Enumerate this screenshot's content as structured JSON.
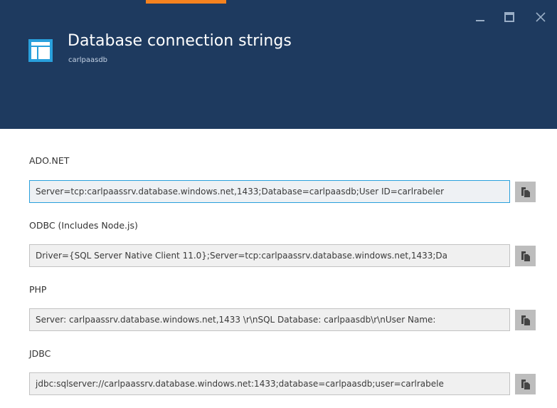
{
  "blade": {
    "title": "Database connection strings",
    "subtitle": "carlpaasdb",
    "icon": "blade-layout-icon",
    "colors": {
      "header_bg": "#1e3a5f",
      "accent": "#f5821f",
      "focus_border": "#29a0dc"
    }
  },
  "window_controls": {
    "minimize_icon": "minimize-icon",
    "maximize_icon": "maximize-icon",
    "close_icon": "close-icon"
  },
  "connection_strings": [
    {
      "label": "ADO.NET",
      "value": "Server=tcp:carlpaassrv.database.windows.net,1433;Database=carlpaasdb;User ID=carlrabeler",
      "copy_icon": "copy-icon"
    },
    {
      "label": "ODBC (Includes Node.js)",
      "value": "Driver={SQL Server Native Client 11.0};Server=tcp:carlpaassrv.database.windows.net,1433;Da",
      "copy_icon": "copy-icon"
    },
    {
      "label": "PHP",
      "value": "Server: carlpaassrv.database.windows.net,1433 \\r\\nSQL Database: carlpaasdb\\r\\nUser Name:",
      "copy_icon": "copy-icon"
    },
    {
      "label": "JDBC",
      "value": "jdbc:sqlserver://carlpaassrv.database.windows.net:1433;database=carlpaasdb;user=carlrabele",
      "copy_icon": "copy-icon"
    }
  ]
}
